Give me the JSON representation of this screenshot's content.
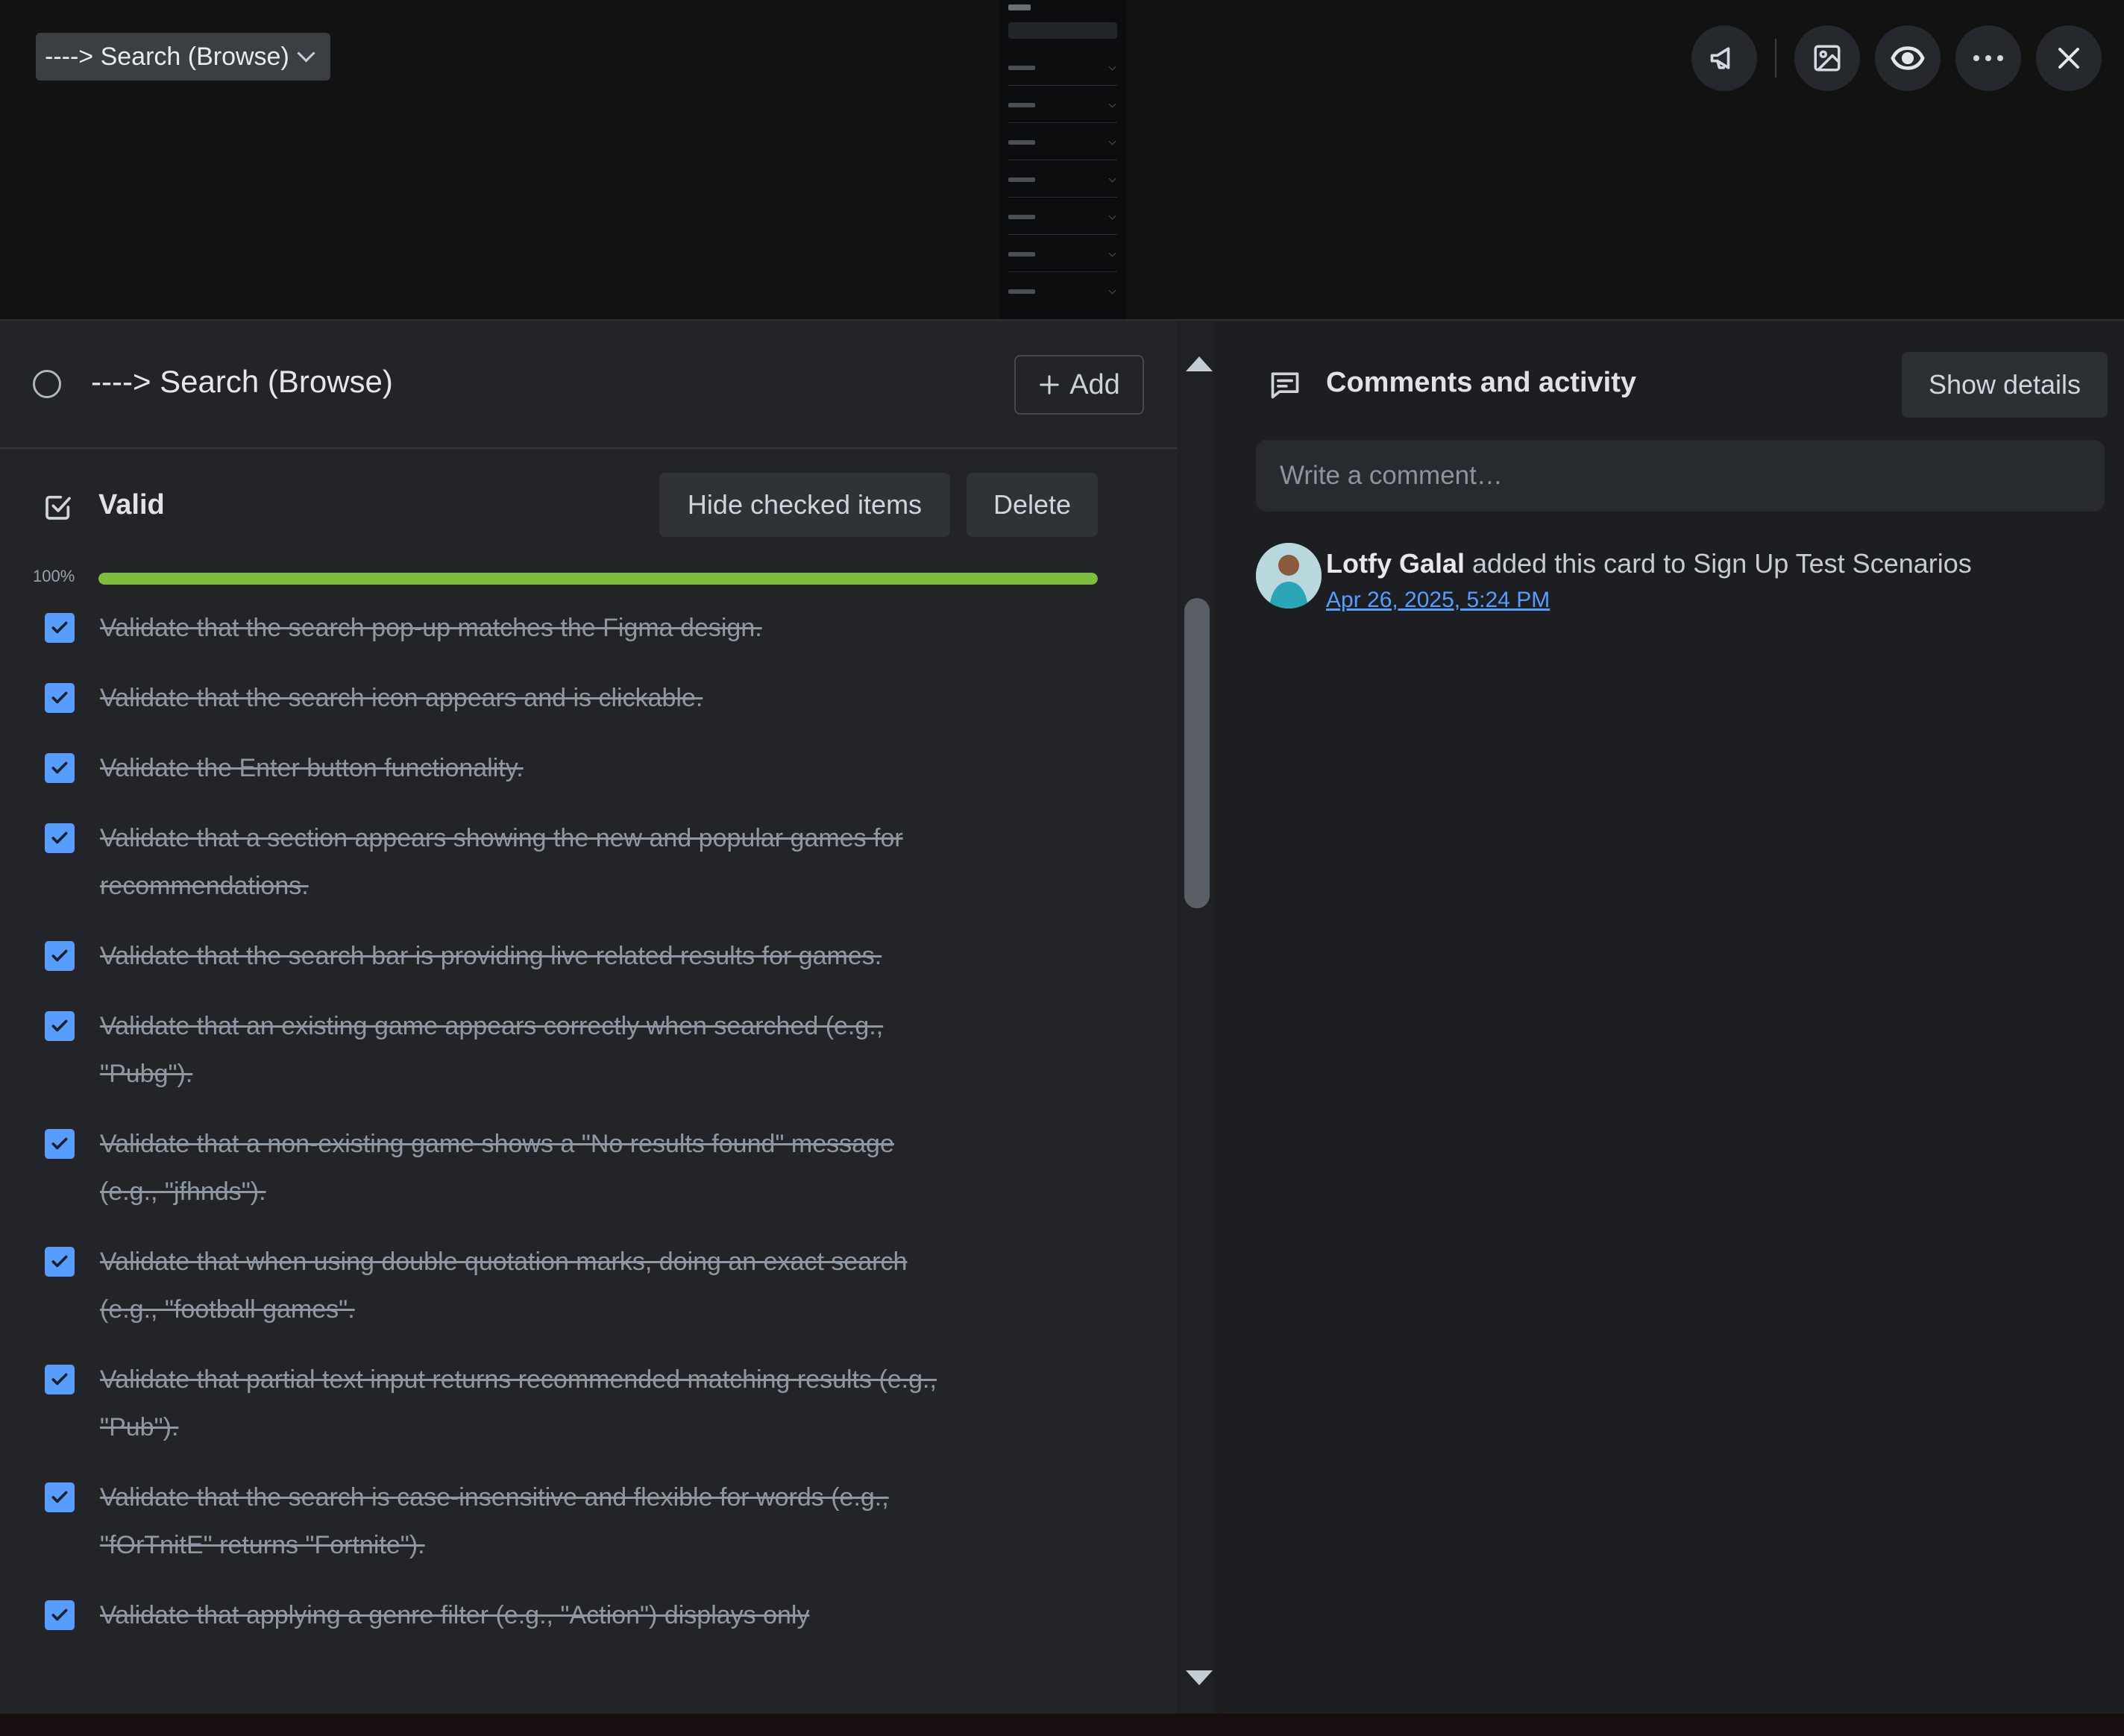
{
  "header": {
    "list_name": "----> Search (Browse)",
    "icons": [
      "megaphone-icon",
      "image-icon",
      "eye-icon",
      "more-icon",
      "close-icon"
    ]
  },
  "card": {
    "title": "----> Search (Browse)",
    "add_label": "Add"
  },
  "checklist": {
    "title": "Valid",
    "hide_checked_label": "Hide checked items",
    "delete_label": "Delete",
    "progress_label": "100%",
    "progress": 1.0,
    "items": [
      {
        "text": "Validate that the search pop-up matches the Figma design.",
        "checked": true
      },
      {
        "text": "Validate that the search icon appears and is clickable.",
        "checked": true
      },
      {
        "text": "Validate the Enter button functionality.",
        "checked": true
      },
      {
        "text": "Validate that a section appears showing the new and popular games for recommendations.",
        "checked": true
      },
      {
        "text": "Validate that the search bar is providing live related results for games.",
        "checked": true
      },
      {
        "text": "Validate that an existing game appears correctly when searched (e.g., \"Pubg\").",
        "checked": true
      },
      {
        "text": "Validate that a non-existing game shows a \"No results found\" message (e.g., \"jfhnds\").",
        "checked": true
      },
      {
        "text": "Validate that when using double quotation marks, doing an exact search (e.g., \"football games\".",
        "checked": true
      },
      {
        "text": "Validate that partial text input returns recommended matching results (e.g., \"Pub\").",
        "checked": true
      },
      {
        "text": "Validate that the search is case-insensitive and flexible for words (e.g., \"fOrTnitE\" returns \"Fortnite\").",
        "checked": true
      },
      {
        "text": "Validate that applying a genre filter (e.g., \"Action\") displays only",
        "checked": true
      }
    ]
  },
  "comments": {
    "title": "Comments and activity",
    "show_details_label": "Show details",
    "placeholder": "Write a comment…",
    "activity": {
      "user": "Lotfy Galal",
      "action": " added this card to Sign Up Test Scenarios",
      "date": "Apr 26, 2025, 5:24 PM"
    }
  },
  "colors": {
    "accent": "#579dff",
    "progress": "#7fbe3c",
    "panel": "#222427"
  }
}
